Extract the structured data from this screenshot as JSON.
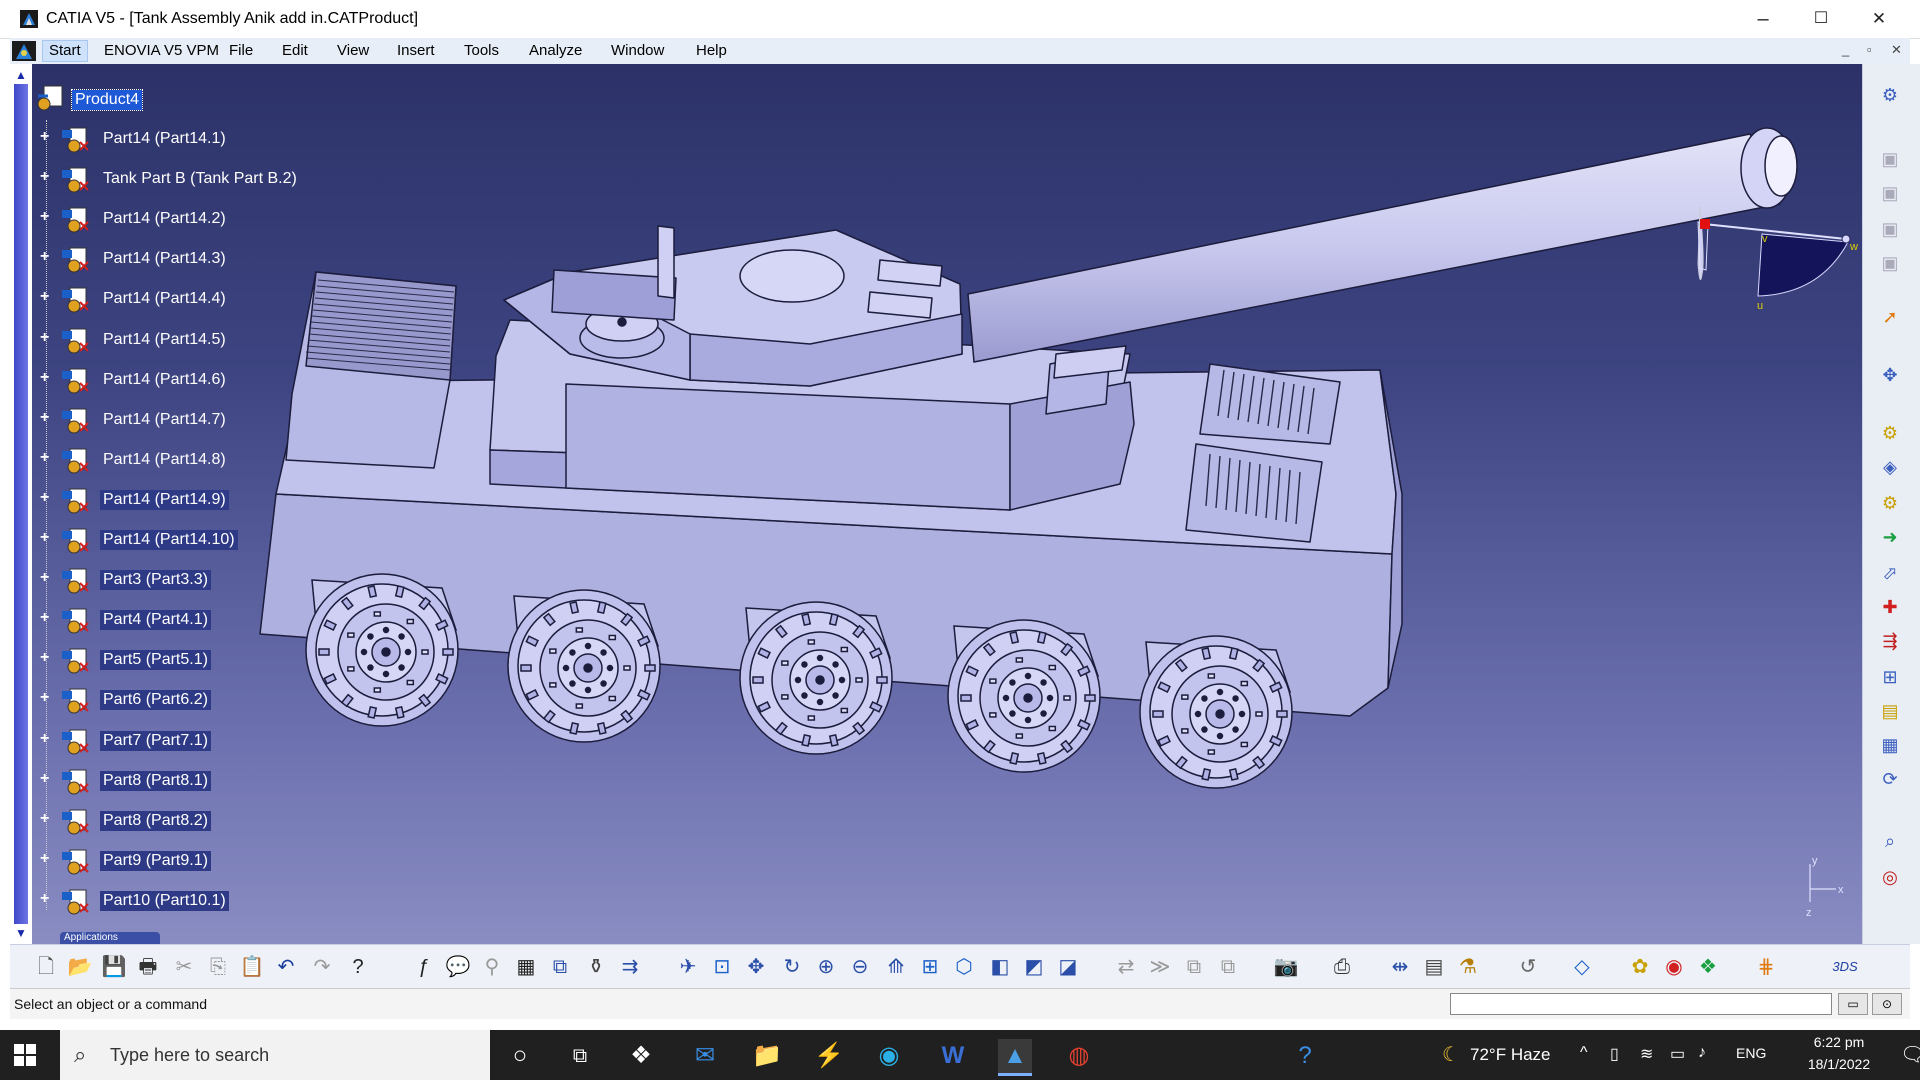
{
  "window": {
    "title": "CATIA V5 - [Tank Assembly Anik add in.CATProduct]",
    "controls": {
      "minimize": "–",
      "maximize": "☐",
      "close": "✕"
    }
  },
  "menubar": {
    "items": [
      "Start",
      "ENOVIA V5 VPM",
      "File",
      "Edit",
      "View",
      "Insert",
      "Tools",
      "Analyze",
      "Window",
      "Help"
    ],
    "mdi_controls": [
      "_",
      "▫",
      "✕"
    ]
  },
  "tree": {
    "root": "Product4",
    "nodes": [
      "Part14 (Part14.1)",
      "Tank Part B (Tank Part B.2)",
      "Part14 (Part14.2)",
      "Part14 (Part14.3)",
      "Part14 (Part14.4)",
      "Part14 (Part14.5)",
      "Part14 (Part14.6)",
      "Part14 (Part14.7)",
      "Part14 (Part14.8)",
      "Part14 (Part14.9)",
      "Part14 (Part14.10)",
      "Part3 (Part3.3)",
      "Part4 (Part4.1)",
      "Part5 (Part5.1)",
      "Part6 (Part6.2)",
      "Part7 (Part7.1)",
      "Part8 (Part8.1)",
      "Part8 (Part8.2)",
      "Part9 (Part9.1)",
      "Part10 (Part10.1)"
    ],
    "applications_tab": "Applications"
  },
  "compass": {
    "u": "u",
    "v": "v",
    "w": "w"
  },
  "axis_labels": {
    "x": "x",
    "y": "y",
    "z": "z"
  },
  "statusbar": {
    "message": "Select an object or a command",
    "power_input_value": ""
  },
  "taskbar": {
    "search_placeholder": "Type here to search",
    "weather": "72°F  Haze",
    "language": "ENG",
    "time": "6:22 pm",
    "date": "18/1/2022"
  },
  "colors": {
    "viewport_top": "#2c3268",
    "viewport_bottom": "#8a8dc2",
    "tank_fill": "#b9b9e6",
    "selection": "#1d58d6"
  }
}
